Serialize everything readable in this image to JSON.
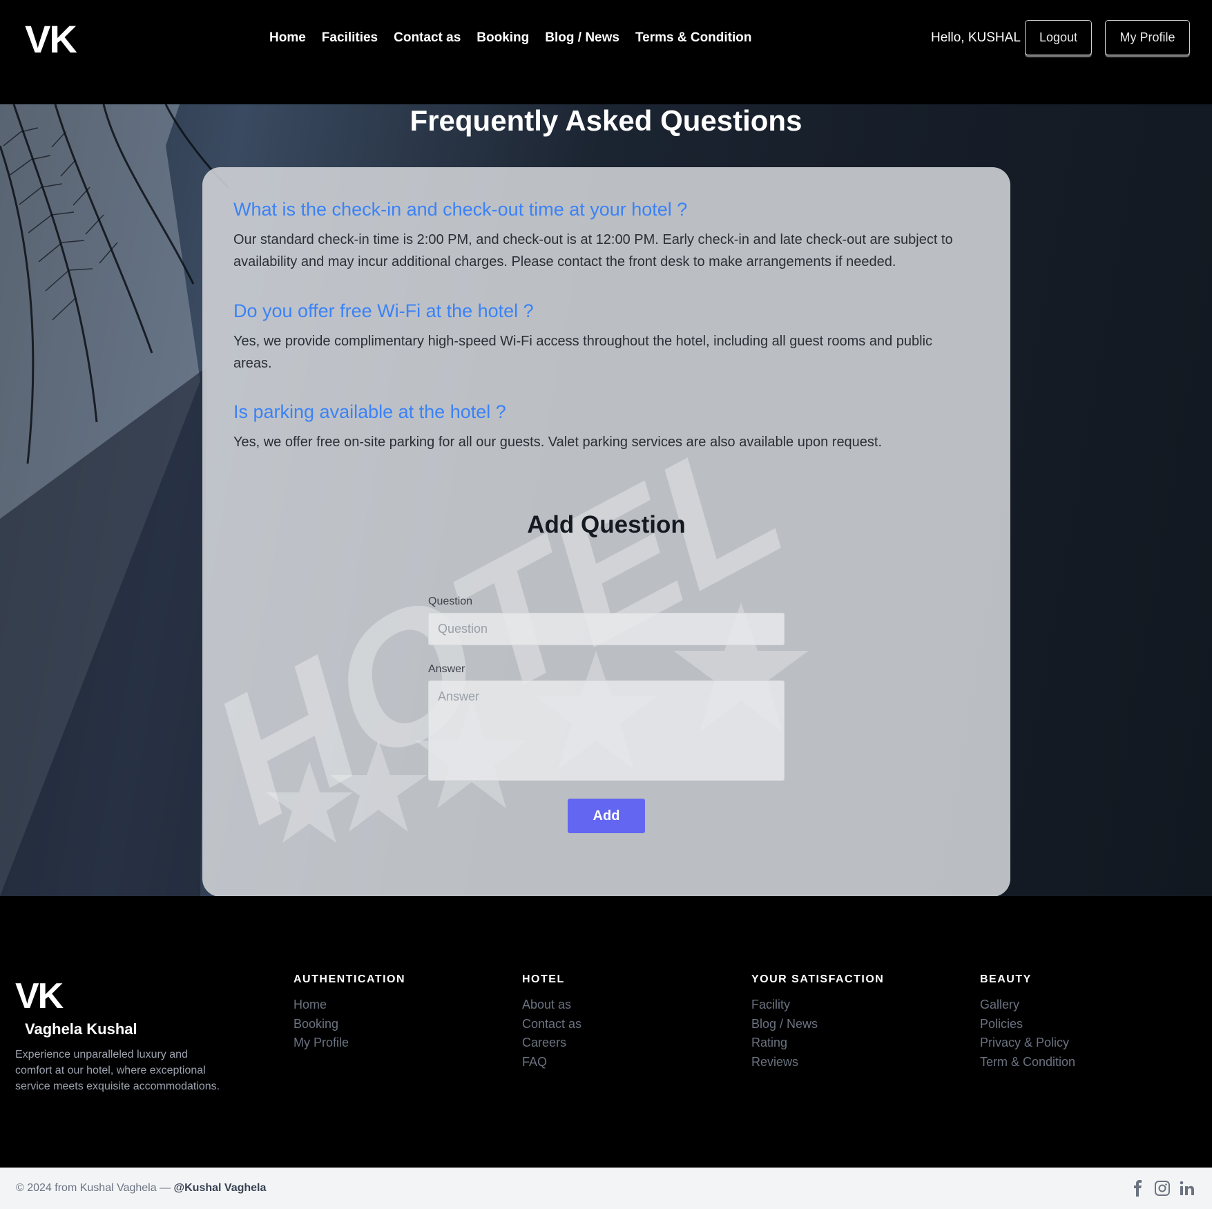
{
  "header": {
    "logo": "VK",
    "nav": [
      "Home",
      "Facilities",
      "Contact as",
      "Booking",
      "Blog / News",
      "Terms & Condition"
    ],
    "greeting": "Hello, KUSHAL",
    "logout_label": "Logout",
    "profile_label": "My Profile"
  },
  "hero": {
    "title": "Frequently Asked Questions",
    "background_text": "HOTEL"
  },
  "faqs": [
    {
      "question": "What is the check-in and check-out time at your hotel ?",
      "answer": "Our standard check-in time is 2:00 PM, and check-out is at 12:00 PM. Early check-in and late check-out are subject to availability and may incur additional charges. Please contact the front desk to make arrangements if needed."
    },
    {
      "question": "Do you offer free Wi-Fi at the hotel ?",
      "answer": "Yes, we provide complimentary high-speed Wi-Fi access throughout the hotel, including all guest rooms and public areas."
    },
    {
      "question": "Is parking available at the hotel ?",
      "answer": "Yes, we offer free on-site parking for all our guests. Valet parking services are also available upon request."
    }
  ],
  "form": {
    "title": "Add Question",
    "question_label": "Question",
    "question_placeholder": "Question",
    "answer_label": "Answer",
    "answer_placeholder": "Answer",
    "submit_label": "Add"
  },
  "footer": {
    "logo": "VK",
    "name": "Vaghela Kushal",
    "description": "Experience unparalleled luxury and comfort at our hotel, where exceptional service meets exquisite accommodations.",
    "columns": [
      {
        "title": "AUTHENTICATION",
        "links": [
          "Home",
          "Booking",
          "My Profile"
        ]
      },
      {
        "title": "HOTEL",
        "links": [
          "About as",
          "Contact as",
          "Careers",
          "FAQ"
        ]
      },
      {
        "title": "YOUR SATISFACTION",
        "links": [
          "Facility",
          "Blog / News",
          "Rating",
          "Reviews"
        ]
      },
      {
        "title": "BEAUTY",
        "links": [
          "Gallery",
          "Policies",
          "Privacy & Policy",
          "Term & Condition"
        ]
      }
    ],
    "copyright_prefix": "© 2024 from Kushal Vaghela —",
    "copyright_handle": "@Kushal Vaghela",
    "social_icons": [
      "facebook-icon",
      "instagram-icon",
      "linkedin-icon"
    ]
  },
  "colors": {
    "accent": "#6366f1",
    "question": "#3b82f6"
  }
}
